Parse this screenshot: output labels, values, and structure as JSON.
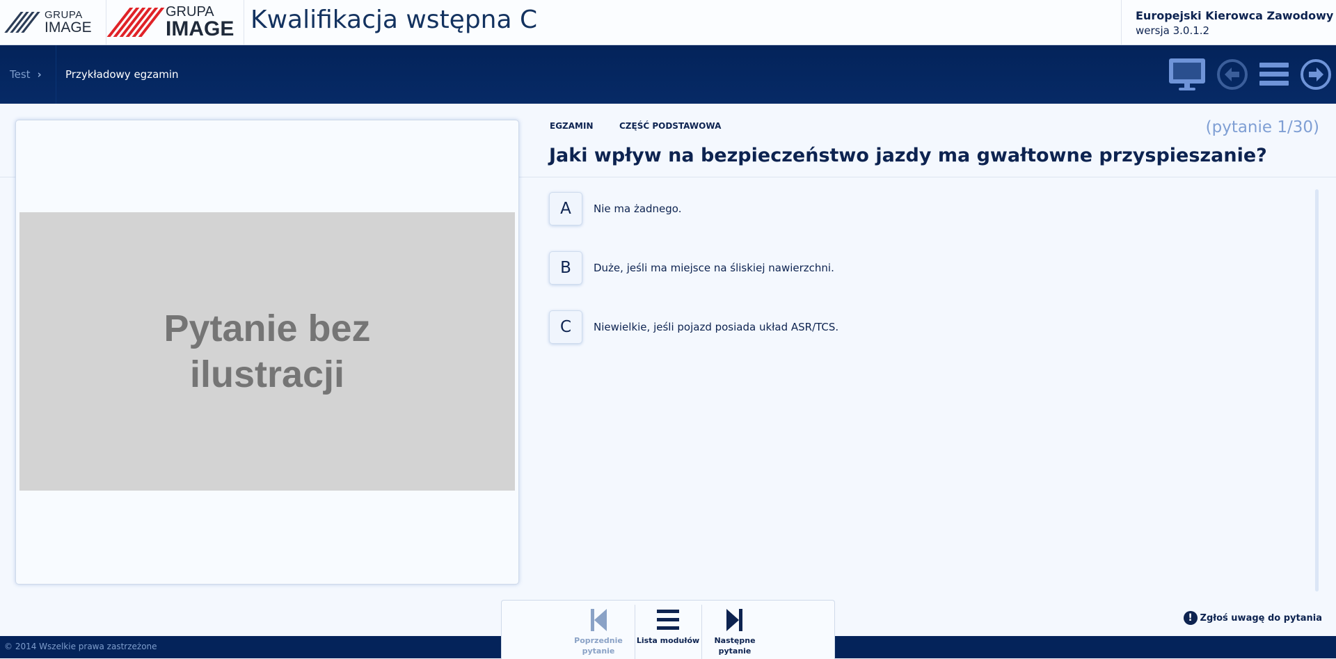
{
  "header": {
    "logo_small": {
      "line1": "GRUPA",
      "line2": "IMAGE"
    },
    "logo_large": {
      "line1": "GRUPA",
      "line2": "IMAGE"
    },
    "app_title": "Kwalifikacja wstępna C",
    "product_name": "Europejski Kierowca Zawodowy",
    "version": "wersja 3.0.1.2"
  },
  "navbar": {
    "breadcrumb_root": "Test",
    "breadcrumb_current": "Przykładowy egzamin",
    "icons": [
      "monitor-icon",
      "back-arrow-icon",
      "menu-icon",
      "forward-arrow-icon"
    ]
  },
  "question": {
    "tag_exam": "EGZAMIN",
    "tag_part": "CZĘŚĆ PODSTAWOWA",
    "counter": "(pytanie 1/30)",
    "text": "Jaki wpływ na bezpieczeństwo jazdy ma gwałtowne przyspieszanie?",
    "image_placeholder": "Pytanie bez ilustracji",
    "answers": [
      {
        "letter": "A",
        "text": "Nie ma żadnego."
      },
      {
        "letter": "B",
        "text": "Duże, jeśli ma miejsce na śliskiej nawierzchni."
      },
      {
        "letter": "C",
        "text": "Niewielkie, jeśli pojazd posiada układ ASR/TCS."
      }
    ]
  },
  "bottom_nav": {
    "prev_label": "Poprzednie pytanie",
    "list_label": "Lista modułów",
    "next_label": "Następne pytanie"
  },
  "report_label": "Zgłoś uwagę do pytania",
  "footer_text": "© 2014 Wszelkie prawa zastrzeżone",
  "colors": {
    "navy": "#0d2350",
    "navbar": "#04235a",
    "accent_light": "#7f9fd4",
    "brand_red": "#e02227",
    "background": "#f4f8fe"
  }
}
